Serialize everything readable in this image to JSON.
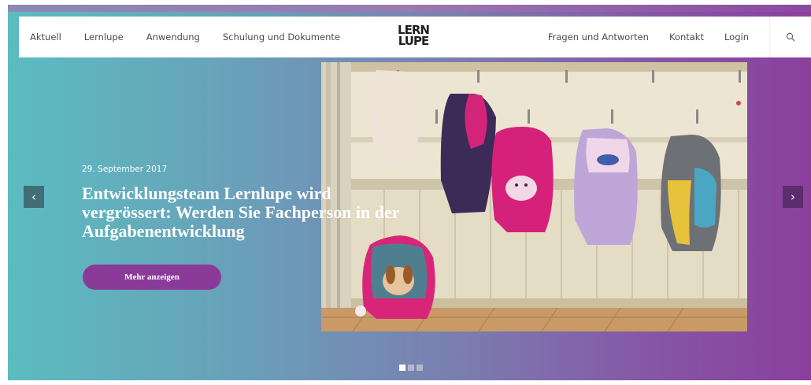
{
  "nav": {
    "left_items": [
      {
        "label": "Aktuell"
      },
      {
        "label": "Lernlupe"
      },
      {
        "label": "Anwendung"
      },
      {
        "label": "Schulung und Dokumente"
      }
    ],
    "logo": {
      "line1": "LERN",
      "line2": "LUPE"
    },
    "right_items": [
      {
        "label": "Fragen und Antworten"
      },
      {
        "label": "Kontakt"
      },
      {
        "label": "Login"
      }
    ],
    "search_icon": "search-icon"
  },
  "slider": {
    "date": "29. September 2017",
    "headline": "Entwicklungsteam Lernlupe wird vergrössert: Werden Sie Fachperson in der Aufgabenentwicklung",
    "button_label": "Mehr anzeigen",
    "prev_icon": "‹",
    "next_icon": "›",
    "slide_count": 3,
    "active_slide": 1,
    "image": "coat-hooks-with-school-backpacks"
  },
  "colors": {
    "accent": "#8a3a99",
    "gradient_left": "#5bbcc0",
    "gradient_right": "#8b3f9e",
    "dot_active": "#ffffff",
    "dot_inactive": "#b7b7cc"
  }
}
